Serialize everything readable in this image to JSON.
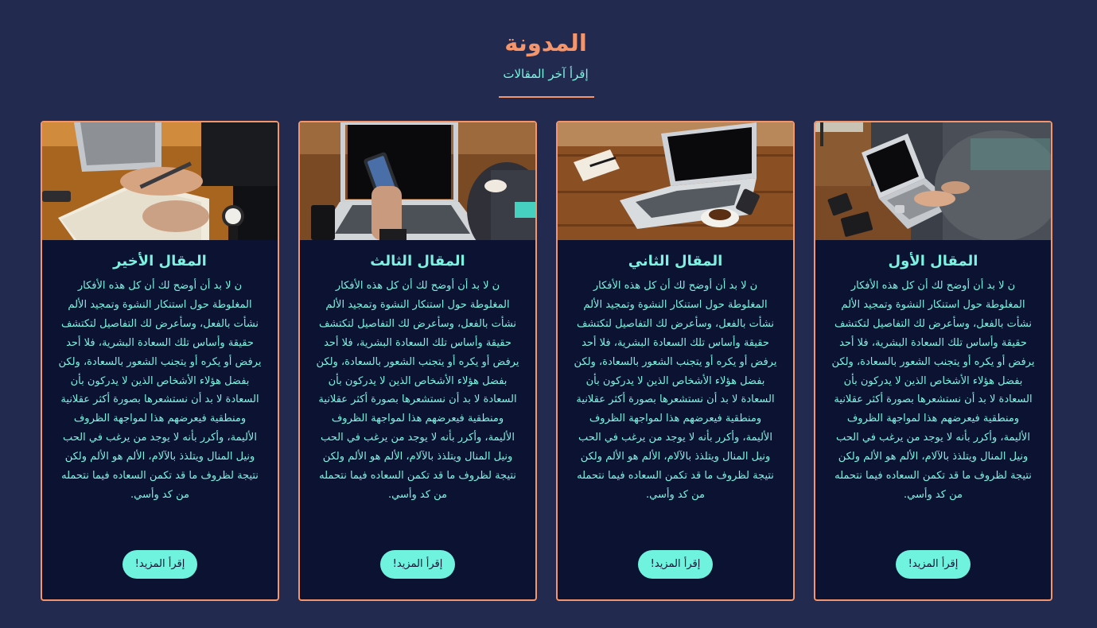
{
  "section": {
    "title": "المدونة",
    "subtitle": "إقرأ آخر المقالات"
  },
  "posts": [
    {
      "title": "المقال الأول",
      "image": "photo-laptop-typing",
      "body": "ن لا بد أن أوضح لك أن كل هذه الأفكار المغلوطة حول استنكار النشوة وتمجيد الألم نشأت بالفعل، وسأعرض لك التفاصيل لتكتشف حقيقة وأساس تلك السعادة البشرية، فلا أحد يرفض أو يكره أو يتجنب الشعور بالسعادة، ولكن بفضل هؤلاء الأشخاص الذين لا يدركون بأن السعادة لا بد أن نستشعرها بصورة أكثر عقلانية ومنطقية فيعرضهم هذا لمواجهة الظروف الأليمة، وأكرر بأنه لا يوجد من يرغب في الحب ونيل المنال ويتلذذ بالآلام، الألم هو الألم ولكن نتيجة لظروف ما قد تكمن السعاده فيما نتحمله من كد وأسي.",
      "button": "إقرأ المزيد!"
    },
    {
      "title": "المقال الثاني",
      "image": "photo-laptop-desk-coffee",
      "body": "ن لا بد أن أوضح لك أن كل هذه الأفكار المغلوطة حول استنكار النشوة وتمجيد الألم نشأت بالفعل، وسأعرض لك التفاصيل لتكتشف حقيقة وأساس تلك السعادة البشرية، فلا أحد يرفض أو يكره أو يتجنب الشعور بالسعادة، ولكن بفضل هؤلاء الأشخاص الذين لا يدركون بأن السعادة لا بد أن نستشعرها بصورة أكثر عقلانية ومنطقية فيعرضهم هذا لمواجهة الظروف الأليمة، وأكرر بأنه لا يوجد من يرغب في الحب ونيل المنال ويتلذذ بالآلام، الألم هو الألم ولكن نتيجة لظروف ما قد تكمن السعاده فيما نتحمله من كد وأسي.",
      "button": "إقرأ المزيد!"
    },
    {
      "title": "المقال الثالث",
      "image": "photo-phone-laptop",
      "body": "ن لا بد أن أوضح لك أن كل هذه الأفكار المغلوطة حول استنكار النشوة وتمجيد الألم نشأت بالفعل، وسأعرض لك التفاصيل لتكتشف حقيقة وأساس تلك السعادة البشرية، فلا أحد يرفض أو يكره أو يتجنب الشعور بالسعادة، ولكن بفضل هؤلاء الأشخاص الذين لا يدركون بأن السعادة لا بد أن نستشعرها بصورة أكثر عقلانية ومنطقية فيعرضهم هذا لمواجهة الظروف الأليمة، وأكرر بأنه لا يوجد من يرغب في الحب ونيل المنال ويتلذذ بالآلام، الألم هو الألم ولكن نتيجة لظروف ما قد تكمن السعاده فيما نتحمله من كد وأسي.",
      "button": "إقرأ المزيد!"
    },
    {
      "title": "المقال الأخير",
      "image": "photo-writing-notebook",
      "body": "ن لا بد أن أوضح لك أن كل هذه الأفكار المغلوطة حول استنكار النشوة وتمجيد الألم نشأت بالفعل، وسأعرض لك التفاصيل لتكتشف حقيقة وأساس تلك السعادة البشرية، فلا أحد يرفض أو يكره أو يتجنب الشعور بالسعادة، ولكن بفضل هؤلاء الأشخاص الذين لا يدركون بأن السعادة لا بد أن نستشعرها بصورة أكثر عقلانية ومنطقية فيعرضهم هذا لمواجهة الظروف الأليمة، وأكرر بأنه لا يوجد من يرغب في الحب ونيل المنال ويتلذذ بالآلام، الألم هو الألم ولكن نتيجة لظروف ما قد تكمن السعاده فيما نتحمله من كد وأسي.",
      "button": "إقرأ المزيد!"
    }
  ],
  "colors": {
    "background": "#222b4f",
    "card_background": "#0b1232",
    "accent": "#f4956c",
    "text": "#7df2e0",
    "button": "#6ff2de"
  }
}
